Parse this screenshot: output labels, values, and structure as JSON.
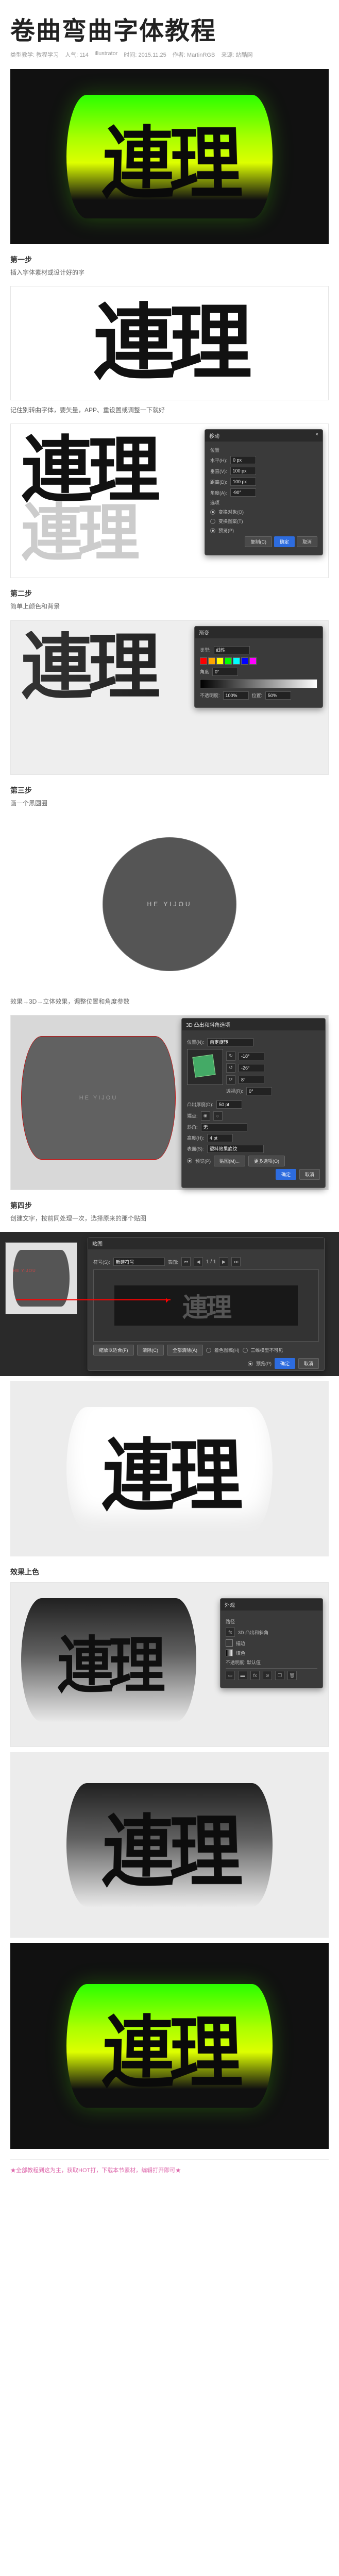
{
  "header": {
    "title": "卷曲弯曲字体教程",
    "meta": {
      "category_label": "类型教学",
      "category": "教程学习",
      "views_label": "人气",
      "views": "114",
      "tool_label": "illustrator",
      "date_label": "时间",
      "date": "2015.11.25",
      "author_label": "作者",
      "author": "MartinRGB",
      "source_label": "来源",
      "source": "站酷网"
    }
  },
  "hero_text": "連理",
  "step1": {
    "label": "第一步",
    "desc": "插入字体素材或设计好的字"
  },
  "note1": "记住别转曲字体，要矢量，APP、重设置或调整一下就好",
  "step2": {
    "label": "第二步",
    "desc": "简单上颜色和背景"
  },
  "step3": {
    "label": "第三步",
    "desc": "画一个黑圆圈"
  },
  "circle_label": "HE YIJOU",
  "note2": "效果→3D→立体效果，调整位置和角度参数",
  "step4": {
    "label": "第四步",
    "desc": "创建文字，按前同处理一次，选择原来的那个贴图"
  },
  "step5_label": "效果上色",
  "footer": "★全部教程到这为主，获取HOT打，下载本节素材，编辑打开即可★",
  "offset_dialog": {
    "title": "移动",
    "close": "×",
    "pos_label": "位置",
    "h_label": "水平(H):",
    "h_val": "0 px",
    "v_label": "垂直(V):",
    "v_val": "100 px",
    "dist_label": "距离(D):",
    "dist_val": "100 px",
    "angle_label": "角度(A):",
    "angle_val": "-90°",
    "opt_label": "选项",
    "opt1": "变换对象(O)",
    "opt2": "变换图案(T)",
    "preview": "预览(P)",
    "copy": "复制(C)",
    "ok": "确定",
    "cancel": "取消"
  },
  "grad_dialog": {
    "title": "渐变",
    "type_label": "类型:",
    "type_val": "线性",
    "angle_label": "角度",
    "angle_val": "0°",
    "opacity_label": "不透明度:",
    "opacity_val": "100%",
    "loc_label": "位置:",
    "loc_val": "50%"
  },
  "revolve_dialog": {
    "title": "3D 凸出和斜角选项",
    "pos_label": "位置(N):",
    "pos_val": "自定旋转",
    "x_val": "-18°",
    "y_val": "-26°",
    "z_val": "8°",
    "persp_label": "透视(R):",
    "persp_val": "0°",
    "extrude_label": "凸出厚度(D):",
    "extrude_val": "50 pt",
    "cap_label": "端点:",
    "bevel_label": "斜角:",
    "bevel_val": "无",
    "height_label": "高度(H):",
    "height_val": "4 pt",
    "surface_label": "表面(S):",
    "surface_val": "塑料效果底纹",
    "preview": "预览(P)",
    "map": "贴图(M)...",
    "more": "更多选项(O)",
    "ok": "确定",
    "cancel": "取消"
  },
  "map_dialog": {
    "title": "贴图",
    "symbol_label": "符号(S):",
    "symbol_val": "新建符号",
    "surface_label": "表面:",
    "surface_nav": "1 / 1",
    "scale": "缩放以适合(F)",
    "clear": "清除(C)",
    "clear_all": "全部清除(A)",
    "shade": "着色图稿(H)",
    "invisible": "三维模型不可见",
    "preview": "预览(P)",
    "ok": "确定",
    "cancel": "取消"
  },
  "appearance_dialog": {
    "title": "外观",
    "item1": "路径",
    "item2": "3D 凸出和斜角",
    "item3": "描边",
    "item4": "填色",
    "opacity": "不透明度: 默认值",
    "fx": "fx"
  }
}
